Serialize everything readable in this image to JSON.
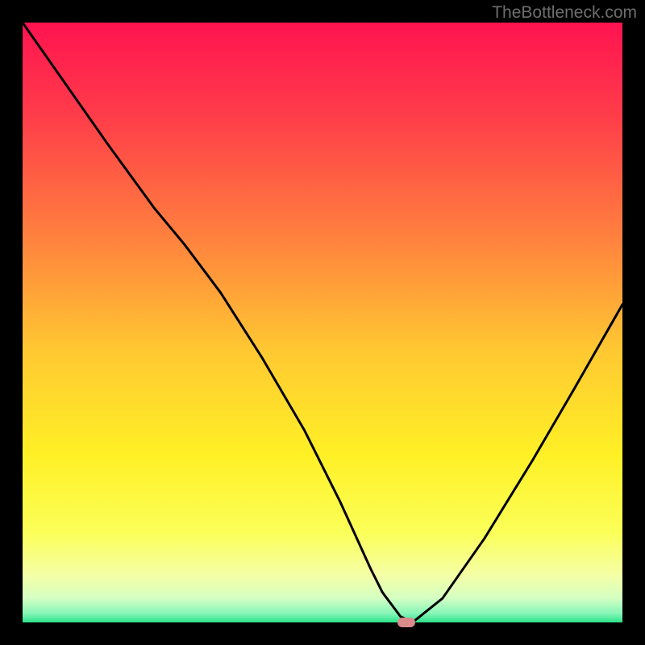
{
  "watermark": "TheBottleneck.com",
  "colors": {
    "bg_outer": "#000000",
    "marker": "#d98b8b",
    "curve": "#000000",
    "gradient_stops": [
      {
        "offset": 0.0,
        "color": "#ff1350"
      },
      {
        "offset": 0.15,
        "color": "#ff3b4a"
      },
      {
        "offset": 0.35,
        "color": "#ff7e3f"
      },
      {
        "offset": 0.55,
        "color": "#ffc931"
      },
      {
        "offset": 0.72,
        "color": "#fff026"
      },
      {
        "offset": 0.85,
        "color": "#fbff58"
      },
      {
        "offset": 0.92,
        "color": "#f5ffa5"
      },
      {
        "offset": 0.96,
        "color": "#d4ffc3"
      },
      {
        "offset": 0.985,
        "color": "#86f6b8"
      },
      {
        "offset": 1.0,
        "color": "#2be28a"
      }
    ]
  },
  "chart_data": {
    "type": "line",
    "title": "",
    "xlabel": "",
    "ylabel": "",
    "xlim": [
      0,
      100
    ],
    "ylim": [
      0,
      100
    ],
    "series": [
      {
        "name": "bottleneck-curve",
        "x": [
          0,
          7,
          14,
          22,
          27,
          33,
          40,
          47,
          53,
          58,
          60,
          63,
          65,
          70,
          77,
          85,
          92,
          100
        ],
        "y": [
          100,
          90,
          80,
          69,
          63,
          55,
          44,
          32,
          20,
          9,
          5,
          1,
          0,
          4,
          14,
          27,
          39,
          53
        ]
      }
    ],
    "marker": {
      "x": 64,
      "y": 0
    },
    "annotations": []
  }
}
